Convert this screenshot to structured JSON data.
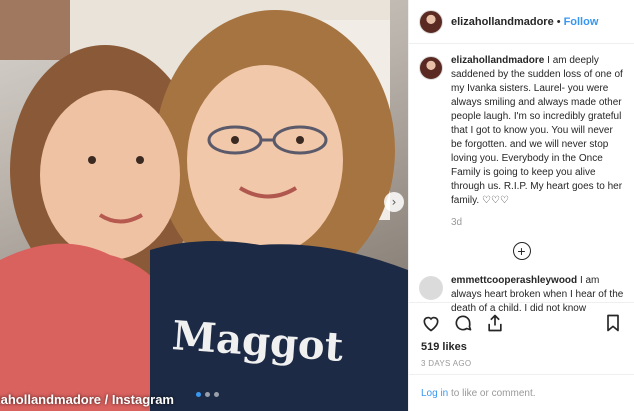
{
  "photo": {
    "shirt_text": "Maggot",
    "credit": "@elizahollandmadore / Instagram",
    "carousel_next_icon": "chevron-right-icon",
    "dots": 3
  },
  "post": {
    "username": "elizahollandmadore",
    "separator": "•",
    "follow_label": "Follow"
  },
  "caption": {
    "username": "elizahollandmadore",
    "text": "I am deeply saddened by the sudden loss of one of my Ivanka sisters. Laurel- you were always smiling and always made other people laugh. I'm so incredibly grateful that I got to know you. You will never be forgotten. and we will never stop loving you. Everybody in the Once Family is going to keep you alive through us. R.I.P. My heart goes to her family. ♡♡♡",
    "time_ago": "3d"
  },
  "load_more_icon": "plus-circle-icon",
  "comment": {
    "username": "emmettcooperashleywood",
    "text": "I am always heart broken when I hear of the death of a child. I did not know"
  },
  "actions": {
    "like_icon": "heart-icon",
    "comment_icon": "comment-icon",
    "share_icon": "share-icon",
    "save_icon": "bookmark-icon"
  },
  "likes": "519 likes",
  "date": "3 DAYS AGO",
  "login": {
    "link": "Log in",
    "rest": "to like or comment."
  },
  "colors": {
    "accent": "#3897f0",
    "text": "#262626",
    "muted": "#999999"
  }
}
